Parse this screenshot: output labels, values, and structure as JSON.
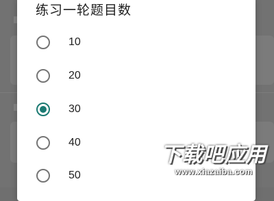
{
  "dialog": {
    "title": "练习一轮题目数",
    "options": [
      {
        "label": "10",
        "checked": false
      },
      {
        "label": "20",
        "checked": false
      },
      {
        "label": "30",
        "checked": true
      },
      {
        "label": "40",
        "checked": false
      },
      {
        "label": "50",
        "checked": false
      }
    ],
    "accent_color": "#1b7a72"
  },
  "watermark": {
    "brand": "下载吧应用",
    "url": "www.xiazaiba.com"
  }
}
